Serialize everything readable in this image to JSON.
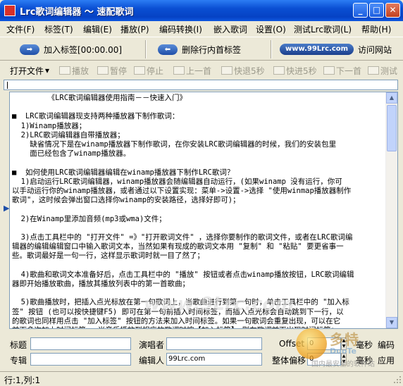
{
  "window": {
    "title": "Lrc歌词编辑器 ～ 速配歌词",
    "min_glyph": "_",
    "max_glyph": "□",
    "close_glyph": "✕"
  },
  "menu": [
    "文件(F)",
    "标签(T)",
    "编辑(E)",
    "播放(P)",
    "编码转换(I)",
    "嵌入歌词",
    "设置(O)",
    "测试Lrc歌词(L)",
    "帮助(H)"
  ],
  "toolbar1": {
    "add_tag": "加入标签[00:00.00]",
    "remove_tag": "删除行内首标签",
    "site_badge": "www.99Lrc.com",
    "visit_site": "访问网站"
  },
  "toolbar2": {
    "open_file": "打开文件",
    "dropdown_glyph": "▾",
    "buttons": [
      "播放",
      "暂停",
      "停止",
      "上一首",
      "快退5秒",
      "快进5秒",
      "下一首",
      "测试"
    ]
  },
  "editor": {
    "lines": [
      "        《LRC歌词编辑器使用指南－－快速入门》",
      "",
      "■  LRC歌词编辑器现支持两种播放器下制作歌词：",
      "  1)Winamp播放器；",
      "  2)LRC歌词编辑器自带播放器；",
      "    缺省情况下是在winamp播放器下制作歌词，在你安装LRC歌词编辑器的时候，我们的安装包里",
      "    面已经包含了winamp播放器。",
      "",
      "■  如何使用LRC歌词编辑器编辑在winamp播放器下制作LRC歌词？",
      "  1)启动运行LRC歌词编辑器，winamp播放器会随编辑器自动运行，(如果winamp 没有运行，你可",
      "以手动运行你的winamp播放器，或者通过以下设置实现：菜单->设置->选择 \"使用winmap播放器制作",
      "歌词\"，这时候会弹出窗口选择你winamp的安装路径，选择好即可)；",
      "",
      "  2)在Winamp里添加音频(mp3或wma)文件；",
      "",
      "  3)点击工具栏中的 \"打开文件\" =》\"打开歌词文件\" ，选择你要制作的歌词文件，或者在LRC歌词编",
      "辑器的编辑编辑窗口中输入歌词文本，当然如果有现成的歌词文本用 \"复制\" 和 \"粘贴\" 要更省事一",
      "些。歌词最好是一句一行，这样显示歌词时就一目了然了；",
      "",
      "  4)歌曲和歌词文本准备好后，点击工具栏中的 \"播放\" 按钮或者点击winamp播放按钮，LRC歌词编辑",
      "器即开始播放歌曲，播放其播放列表中的第一首歌曲；",
      "",
      "  5)歌曲播放时，把插入点光标放在第一句歌词上，当歌曲进行到第一句时，单击工具栏中的 \"加入标",
      "签\" 按钮 (也可以按快捷键F5) 即可在第一句前插入时间标签，而插入点光标会自动跳到下一行，以",
      "的歌词也同样用点击 \"加入标签\" 按钮的方法来加入时间标签。如果一句歌词会重复出现，可以在它",
      "前面多次加上时间标签 ，当音乐播放到相应的歌词时按【加入标签】，则在歌词前面出现时间标签；"
    ]
  },
  "form": {
    "title_label": "标题",
    "title_value": "",
    "artist_label": "演唱者",
    "artist_value": "",
    "offset_label": "Offset",
    "offset_value": "0",
    "offset_unit": "毫秒",
    "encode_button": "编码",
    "album_label": "专辑",
    "album_value": "",
    "editor_label": "编辑人",
    "editor_value": "99Lrc.com",
    "shift_label": "整体偏移",
    "shift_value": "0",
    "shift_unit": "毫秒",
    "apply_button": "应用"
  },
  "status": {
    "position": "行:1,列:1"
  },
  "watermark": {
    "logo_text": "多特",
    "sub_text": "DuoTe",
    "caption": "国内最安全的软件站",
    "center_text": "www.9Lrc.com"
  }
}
